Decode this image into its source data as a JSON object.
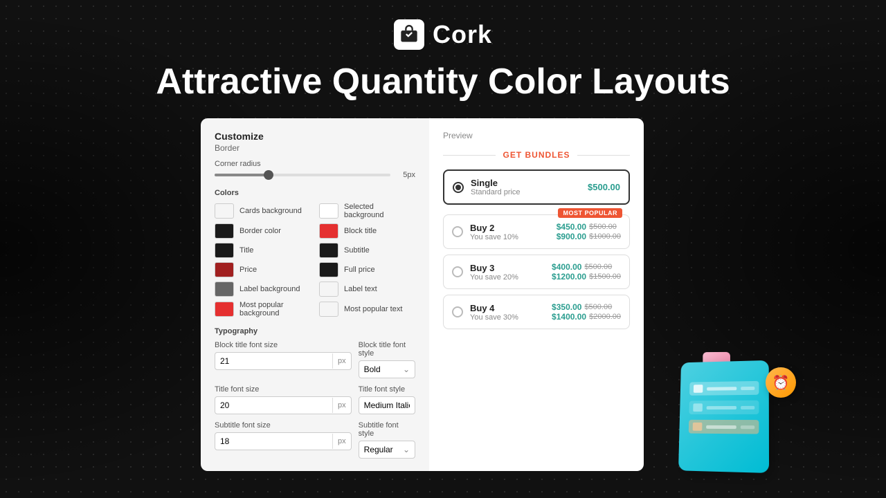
{
  "brand": {
    "name": "Cork"
  },
  "headline": "Attractive Quantity Color Layouts",
  "customize_panel": {
    "title": "Customize",
    "subtitle": "Border",
    "corner_radius_label": "Corner radius",
    "slider_value": "5px",
    "colors_section_label": "Colors",
    "colors": [
      {
        "label": "Cards background",
        "hex": "#f5f5f5",
        "side": "left"
      },
      {
        "label": "Selected background",
        "hex": "#ffffff",
        "side": "right"
      },
      {
        "label": "Border color",
        "hex": "#222222",
        "side": "left"
      },
      {
        "label": "Block title",
        "hex": "#e53030",
        "side": "right"
      },
      {
        "label": "Title",
        "hex": "#222222",
        "side": "left"
      },
      {
        "label": "Subtitle",
        "hex": "#222222",
        "side": "right"
      },
      {
        "label": "Price",
        "hex": "#a12020",
        "side": "left"
      },
      {
        "label": "Full price",
        "hex": "#222222",
        "side": "right"
      },
      {
        "label": "Label background",
        "hex": "#666666",
        "side": "left"
      },
      {
        "label": "Label text",
        "hex": "#f5f5f5",
        "side": "right"
      },
      {
        "label": "Most popular background",
        "hex": "#e53030",
        "side": "left"
      },
      {
        "label": "Most popular text",
        "hex": "#f5f5f5",
        "side": "right"
      }
    ],
    "typography_label": "Typography",
    "block_title_font_size_label": "Block title font size",
    "block_title_font_size_value": "21",
    "block_title_font_size_unit": "px",
    "block_title_font_style_label": "Block title font style",
    "block_title_font_style_value": "Bold",
    "title_font_size_label": "Title font size",
    "title_font_size_value": "20",
    "title_font_size_unit": "px",
    "title_font_style_label": "Title font style",
    "title_font_style_value": "Medium Italic",
    "subtitle_font_size_label": "Subtitle font size",
    "subtitle_font_size_value": "18",
    "subtitle_font_size_unit": "px",
    "subtitle_font_style_label": "Subtitle font style",
    "subtitle_font_style_value": "Regular"
  },
  "preview_panel": {
    "label": "Preview",
    "bundles_title": "GET BUNDLES",
    "bundles": [
      {
        "id": "single",
        "name": "Single",
        "subtitle": "Standard price",
        "price_current": "$500.00",
        "price_original": null,
        "savings": null,
        "selected": true,
        "most_popular": false
      },
      {
        "id": "buy2",
        "name": "Buy 2",
        "subtitle": "You save 10%",
        "price_current": "$450.00",
        "price_original": "$500.00",
        "price_current2": "$900.00",
        "price_original2": "$1000.00",
        "selected": false,
        "most_popular": true,
        "most_popular_label": "MOST POPULAR"
      },
      {
        "id": "buy3",
        "name": "Buy 3",
        "subtitle": "You save 20%",
        "price_current": "$400.00",
        "price_original": "$500.00",
        "price_current2": "$1200.00",
        "price_original2": "$1500.00",
        "selected": false,
        "most_popular": false
      },
      {
        "id": "buy4",
        "name": "Buy 4",
        "subtitle": "You save 30%",
        "price_current": "$350.00",
        "price_original": "$500.00",
        "price_current2": "$1400.00",
        "price_original2": "$2000.00",
        "selected": false,
        "most_popular": false
      }
    ]
  }
}
